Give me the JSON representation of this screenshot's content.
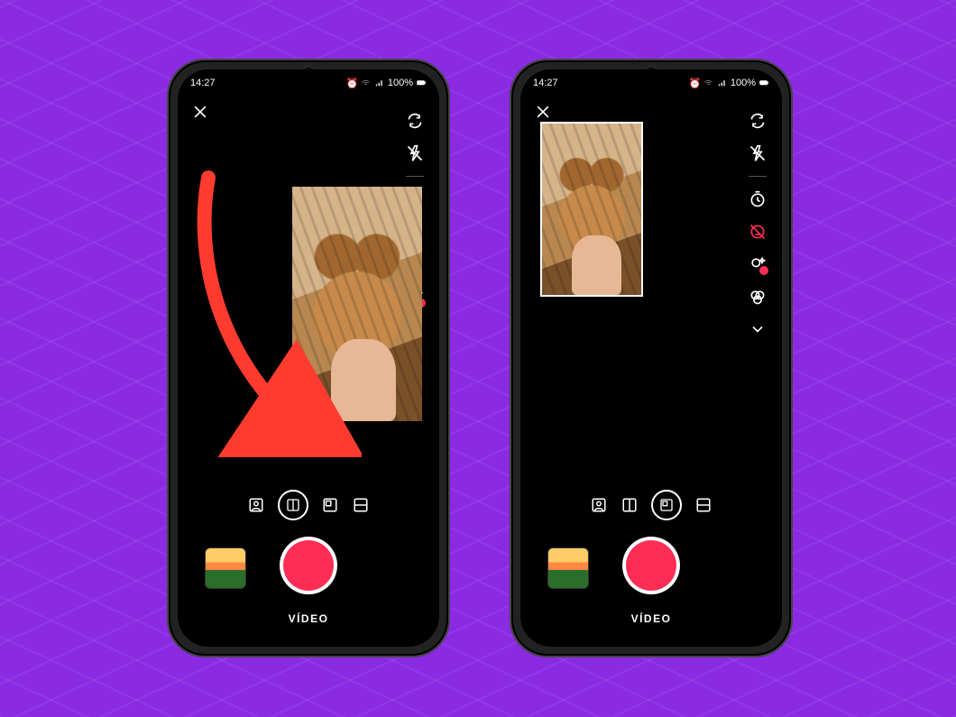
{
  "status": {
    "time": "14:27",
    "battery_text": "100%"
  },
  "mode_label": "VÍDEO",
  "colors": {
    "accent": "#ff2d55",
    "bg_purple": "#8a2be2"
  },
  "icons": {
    "close": "close-icon",
    "flip": "camera-flip-icon",
    "flash_off": "flash-off-icon",
    "timer": "timer-icon",
    "swap": "swap-icon",
    "beauty_off": "beauty-off-icon",
    "effects": "effects-icon",
    "filters": "filters-icon",
    "chevron_down": "chevron-down-icon",
    "layout_green": "layout-green-screen-icon",
    "layout_side": "layout-side-by-side-icon",
    "layout_pip": "layout-pip-icon",
    "layout_stacked": "layout-stacked-icon"
  },
  "phones": {
    "left": {
      "selected_layout": "side",
      "preview_style": "half-right"
    },
    "right": {
      "selected_layout": "pip",
      "preview_style": "pip-top-left"
    }
  }
}
